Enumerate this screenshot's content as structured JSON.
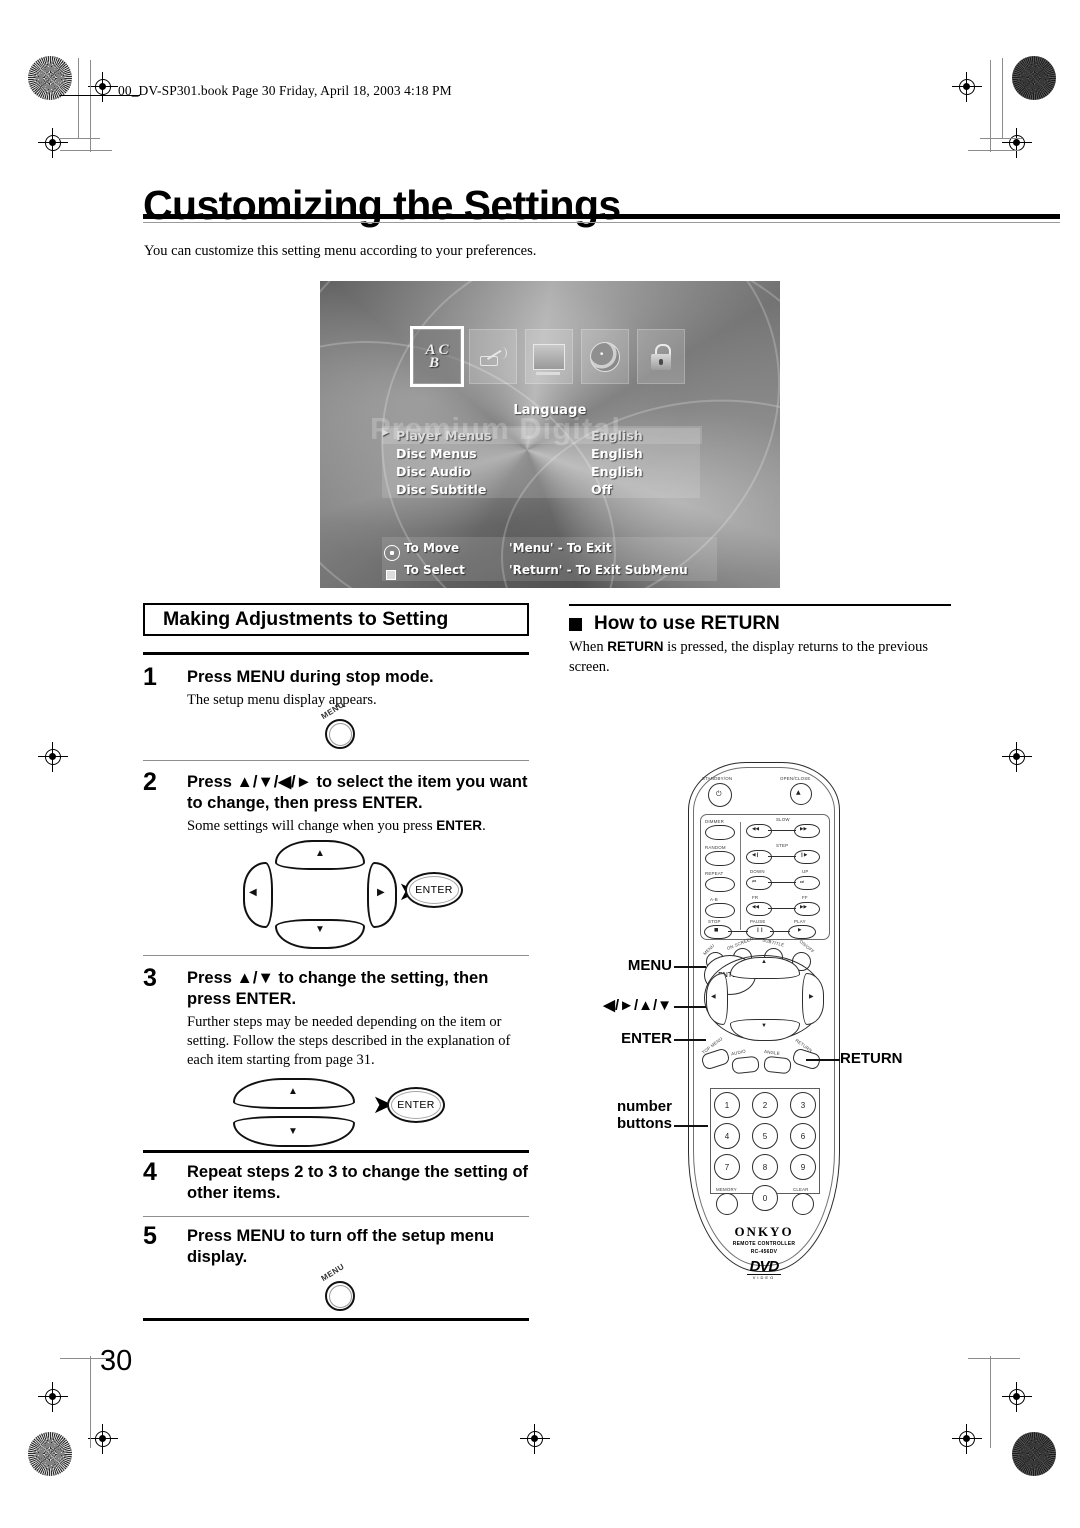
{
  "header": {
    "file_stamp": "00_DV-SP301.book  Page 30  Friday, April 18, 2003  4:18 PM"
  },
  "page": {
    "title": "Customizing the Settings",
    "intro": "You can customize this setting menu according to your preferences.",
    "number": "30"
  },
  "osd": {
    "ghost_text": "Premium Digital",
    "menu_title": "Language",
    "icons": [
      {
        "name": "language-icon",
        "glyph_line1": "A C",
        "glyph_line2": "B"
      },
      {
        "name": "audio-icon"
      },
      {
        "name": "display-icon"
      },
      {
        "name": "disc-icon"
      },
      {
        "name": "parental-lock-icon"
      }
    ],
    "rows": [
      {
        "label": "Player Menus",
        "value": "English",
        "selected": true
      },
      {
        "label": "Disc Menus",
        "value": "English",
        "selected": false
      },
      {
        "label": "Disc Audio",
        "value": "English",
        "selected": false
      },
      {
        "label": "Disc Subtitle",
        "value": "Off",
        "selected": false
      }
    ],
    "footer": [
      {
        "left": "To Move",
        "right": "'Menu' - To Exit",
        "icon": "dpad-icon"
      },
      {
        "left": "To Select",
        "right": "'Return' - To Exit SubMenu",
        "icon": "enter-square-icon"
      }
    ]
  },
  "left_column": {
    "section_title": "Making Adjustments to Setting",
    "steps": [
      {
        "number": "1",
        "heading": "Press MENU during stop mode.",
        "body": "The setup menu display appears.",
        "figure": "menu-button"
      },
      {
        "number": "2",
        "heading": "Press ▲/▼/◀/► to select the item you want to change, then press ENTER.",
        "body_pre": "Some settings will change when you press ",
        "body_bold": "ENTER",
        "body_post": ".",
        "figure": "dpad-to-enter"
      },
      {
        "number": "3",
        "heading": "Press ▲/▼ to change the setting, then press ENTER.",
        "body": "Further steps may be needed depending on the item or setting. Follow the steps described in the explanation of each item starting from page 31.",
        "figure": "updown-to-enter"
      },
      {
        "number": "4",
        "heading": "Repeat steps 2 to 3 to change the setting of other items.",
        "body": "",
        "figure": ""
      },
      {
        "number": "5",
        "heading": "Press MENU to turn off the setup menu display.",
        "body": "",
        "figure": "menu-button"
      }
    ],
    "enter_label": "ENTER",
    "menu_label": "MENU"
  },
  "right_column": {
    "heading": "How to use RETURN",
    "body_pre": "When ",
    "body_bold": "RETURN",
    "body_post": " is pressed, the display returns to the previous screen."
  },
  "remote": {
    "callouts": {
      "menu": "MENU",
      "dpad": "◀/►/▲/▼",
      "enter": "ENTER",
      "numbers_line1": "number",
      "numbers_line2": "buttons",
      "return": "RETURN"
    },
    "top_buttons": [
      {
        "label": "STANDBY/ON",
        "glyph": "⏻"
      },
      {
        "label": "OPEN/CLOSE",
        "glyph": "▲"
      }
    ],
    "transport_rows": [
      {
        "left_label": "DIMMER",
        "pair_label": "SLOW",
        "a": "◀◀",
        "b": "▶▶"
      },
      {
        "left_label": "RANDOM",
        "pair_label": "STEP",
        "a": "◀❙",
        "b": "❙▶"
      },
      {
        "left_label": "REPEAT",
        "label_a": "DOWN",
        "label_b": "UP",
        "a": "⏮",
        "b": "⏭"
      },
      {
        "left_label": "A-B",
        "label_a": "FR",
        "label_b": "FF",
        "a": "◀◀",
        "b": "▶▶"
      }
    ],
    "bottom_transport": [
      {
        "label": "STOP",
        "glyph": "■"
      },
      {
        "label": "PAUSE",
        "glyph": "❙❙"
      },
      {
        "label": "PLAY",
        "glyph": "▶"
      }
    ],
    "menu_row": [
      "MENU",
      "ON SCREEN",
      "SUBTITLE",
      "ON/OFF"
    ],
    "sub_row": [
      "TOP MENU",
      "AUDIO",
      "ANGLE",
      "RETURN"
    ],
    "enter_label": "ENTER",
    "numbers": [
      "1",
      "2",
      "3",
      "4",
      "5",
      "6",
      "7",
      "8",
      "9",
      "0"
    ],
    "memory_label": "MEMORY",
    "clear_label": "CLEAR",
    "brand": "ONKYO",
    "model_line1": "REMOTE CONTROLLER",
    "model_line2": "RC-456DV",
    "logo_text": "DVD",
    "logo_sub": "VIDEO"
  }
}
